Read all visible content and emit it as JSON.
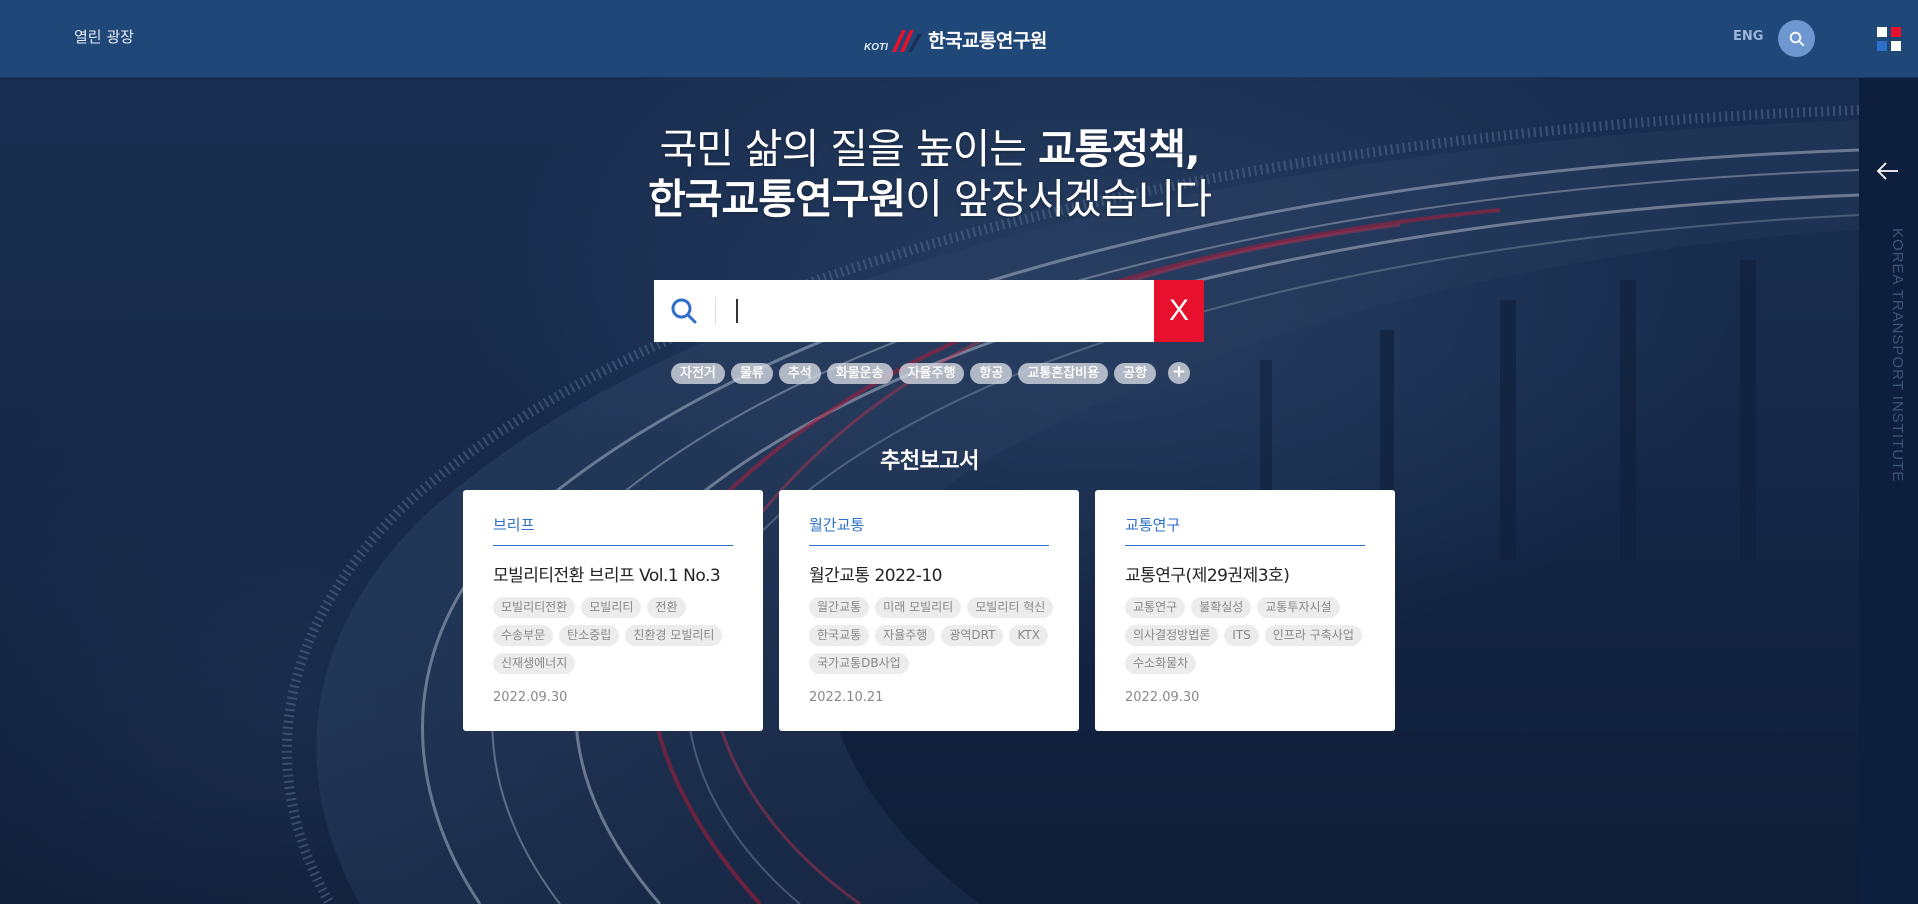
{
  "header": {
    "left_link": "열린 광장",
    "logo_badge": "KOTI",
    "logo_name": "한국교통연구원",
    "lang_link": "ENG",
    "icons": {
      "search": "search-icon",
      "menu": "grid-menu-icon"
    },
    "menu_colors": [
      "#ffffff",
      "#e8112d",
      "#2e6fc9",
      "#ffffff"
    ]
  },
  "rail": {
    "back_icon": "arrow-left-icon",
    "vertical_text": "KOREA TRANSPORT INSTITUTE"
  },
  "hero": {
    "line1_normal": "국민 삶의 질을 높이는 ",
    "line1_bold": "교통정책,",
    "line2_bold": "한국교통연구원",
    "line2_normal": "이 앞장서겠습니다"
  },
  "search": {
    "value": "",
    "placeholder": "",
    "clear_label": "X",
    "icon": "search-icon"
  },
  "popular_tags": [
    "자전거",
    "물류",
    "추석",
    "화물운송",
    "자율주행",
    "항공",
    "교통혼잡비용",
    "공항"
  ],
  "more_tags_label": "+",
  "section_title": "추천보고서",
  "cards": [
    {
      "category": "브리프",
      "title": "모빌리티전환 브리프 Vol.1 No.3",
      "tags": [
        "모빌리티전환",
        "모빌리티",
        "전환",
        "수송부문",
        "탄소중립",
        "친환경 모빌리티",
        "신재생에너지"
      ],
      "date": "2022.09.30"
    },
    {
      "category": "월간교통",
      "title": "월간교통 2022-10",
      "tags": [
        "월간교통",
        "미래 모빌리티",
        "모빌리티 혁신",
        "한국교통",
        "자율주행",
        "광역DRT",
        "KTX",
        "국가교통DB사업"
      ],
      "date": "2022.10.21"
    },
    {
      "category": "교통연구",
      "title": "교통연구(제29권제3호)",
      "tags": [
        "교통연구",
        "불확실성",
        "교통투자시설",
        "의사결정방법론",
        "ITS",
        "인프라 구축사업",
        "수소화물차"
      ],
      "date": "2022.09.30"
    }
  ],
  "colors": {
    "header_bg": "#1f4778",
    "accent_blue": "#2e6fc9",
    "accent_red": "#e8112d",
    "rail_bg": "#0d1f3c"
  }
}
